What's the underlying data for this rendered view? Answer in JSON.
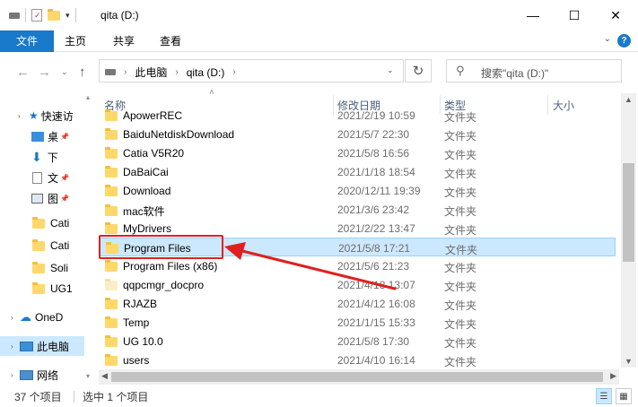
{
  "window": {
    "title": "qita (D:)",
    "minimize_glyph": "—",
    "maximize_glyph": "☐",
    "close_glyph": "✕"
  },
  "ribbon": {
    "tabs": [
      "文件",
      "主页",
      "共享",
      "查看"
    ],
    "help_glyph": "?"
  },
  "address": {
    "segments": [
      "此电脑",
      "qita (D:)"
    ],
    "search_placeholder": "搜索\"qita (D:)\""
  },
  "nav_pane": {
    "items": [
      {
        "label": "快速访",
        "icon": "star-icon"
      },
      {
        "label": "桌",
        "icon": "desktop-icon"
      },
      {
        "label": "下",
        "icon": "download-icon"
      },
      {
        "label": "文",
        "icon": "document-icon"
      },
      {
        "label": "图",
        "icon": "picture-icon"
      },
      {
        "label": "Cati",
        "icon": "folder-icon"
      },
      {
        "label": "Cati",
        "icon": "folder-icon"
      },
      {
        "label": "Soli",
        "icon": "folder-icon"
      },
      {
        "label": "UG1",
        "icon": "folder-icon"
      },
      {
        "label": "OneD",
        "icon": "cloud-icon"
      },
      {
        "label": "此电脑",
        "icon": "computer-icon"
      },
      {
        "label": "网络",
        "icon": "network-icon"
      }
    ]
  },
  "columns": {
    "name": "名称",
    "date": "修改日期",
    "type": "类型",
    "size": "大小"
  },
  "files": [
    {
      "name": "ApowerREC",
      "date": "2021/2/19 10:59",
      "type": "文件夹"
    },
    {
      "name": "BaiduNetdiskDownload",
      "date": "2021/5/7 22:30",
      "type": "文件夹"
    },
    {
      "name": "Catia V5R20",
      "date": "2021/5/8 16:56",
      "type": "文件夹"
    },
    {
      "name": "DaBaiCai",
      "date": "2021/1/18 18:54",
      "type": "文件夹"
    },
    {
      "name": "Download",
      "date": "2020/12/11 19:39",
      "type": "文件夹"
    },
    {
      "name": "mac软件",
      "date": "2021/3/6 23:42",
      "type": "文件夹"
    },
    {
      "name": "MyDrivers",
      "date": "2021/2/22 13:47",
      "type": "文件夹"
    },
    {
      "name": "Program Files",
      "date": "2021/5/8 17:21",
      "type": "文件夹",
      "selected": true
    },
    {
      "name": "Program Files (x86)",
      "date": "2021/5/6 21:23",
      "type": "文件夹"
    },
    {
      "name": "qqpcmgr_docpro",
      "date": "2021/4/18 13:07",
      "type": "文件夹",
      "pale": true
    },
    {
      "name": "RJAZB",
      "date": "2021/4/12 16:08",
      "type": "文件夹"
    },
    {
      "name": "Temp",
      "date": "2021/1/15 15:33",
      "type": "文件夹"
    },
    {
      "name": "UG 10.0",
      "date": "2021/5/8 17:30",
      "type": "文件夹"
    },
    {
      "name": "users",
      "date": "2021/4/10 16:14",
      "type": "文件夹"
    }
  ],
  "status": {
    "count": "37 个项目",
    "selection": "选中 1 个项目"
  },
  "colors": {
    "accent": "#1979ca",
    "selection": "#cce8ff",
    "annotation": "#e02020"
  }
}
